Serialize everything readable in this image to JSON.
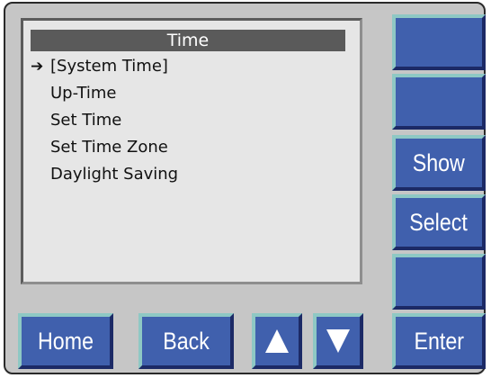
{
  "screen": {
    "title": "Time",
    "selected_marker": "➔",
    "items": [
      {
        "label": "[System Time]"
      },
      {
        "label": "Up-Time"
      },
      {
        "label": "Set Time"
      },
      {
        "label": "Set Time Zone"
      },
      {
        "label": "Daylight Saving"
      }
    ]
  },
  "side_buttons": {
    "show_label": "Show",
    "select_label": "Select",
    "enter_label": "Enter"
  },
  "bottom_buttons": {
    "home_label": "Home",
    "back_label": "Back",
    "up_icon": "arrow-up-icon",
    "down_icon": "arrow-down-icon"
  },
  "colors": {
    "button_face": "#4060ad",
    "button_highlight": "#8ec8c4",
    "button_shadow": "#1c2a66",
    "panel_bg": "#c6c6c6",
    "screen_bg": "#e6e6e6",
    "title_bar": "#5a5a5a"
  }
}
